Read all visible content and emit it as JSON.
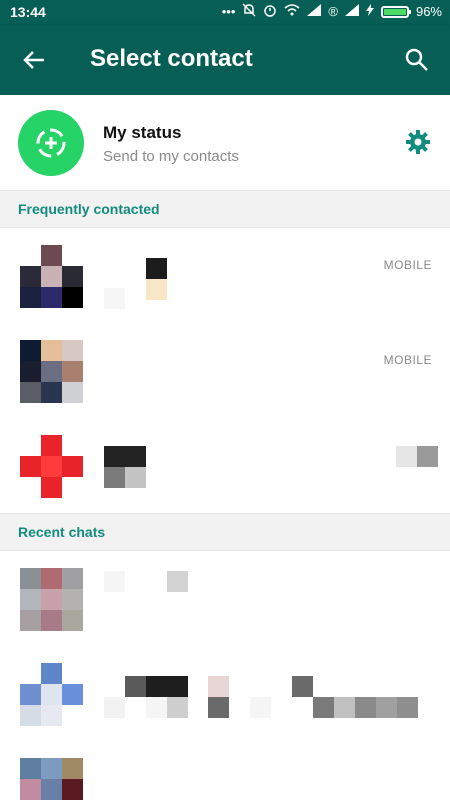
{
  "status_bar": {
    "time": "13:44",
    "signal_r": "®",
    "battery": "96%"
  },
  "app_bar": {
    "title": "Select contact",
    "back_icon": "arrow-back-icon",
    "search_icon": "search-icon"
  },
  "my_status": {
    "title": "My status",
    "subtitle": "Send to my contacts",
    "icon": "status-add-icon",
    "settings_icon": "gear-icon"
  },
  "sections": {
    "frequent": "Frequently contacted",
    "recent": "Recent chats"
  },
  "frequent_contacts": [
    {
      "type": "MOBILE"
    },
    {
      "type": "MOBILE"
    },
    {
      "type": ""
    }
  ],
  "recent_contacts": [
    {
      "type": ""
    },
    {
      "type": ""
    },
    {
      "type": ""
    }
  ],
  "colors": {
    "primary": "#075e54",
    "accent": "#25d366",
    "section_text": "#128c7e"
  }
}
